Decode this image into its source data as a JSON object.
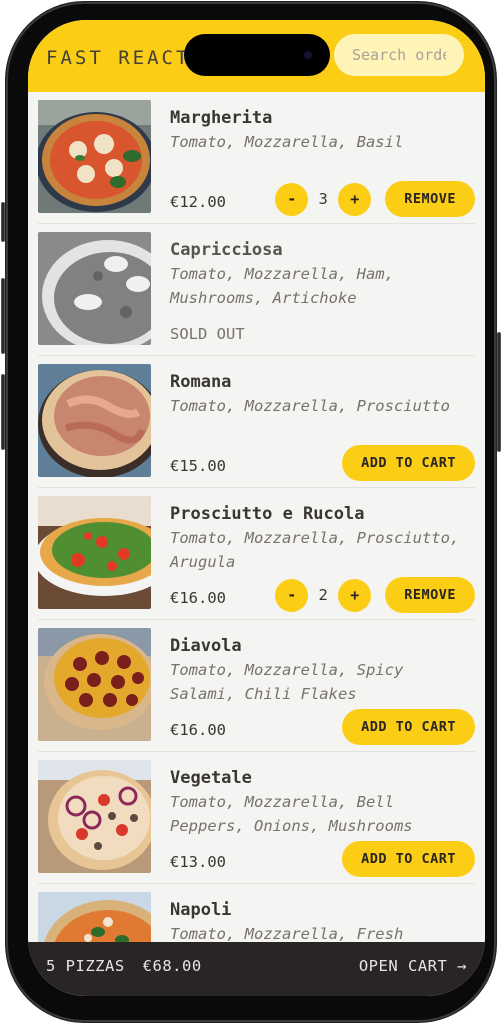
{
  "header": {
    "brand": "FAST REACT",
    "search_placeholder": "Search order #"
  },
  "colors": {
    "accent": "#fbcd15",
    "search_bg": "#fef4b8",
    "cart_bar_bg": "#292524",
    "text_primary": "#3a3632",
    "text_muted": "#78716c"
  },
  "menu": [
    {
      "name": "Margherita",
      "ingredients": "Tomato, Mozzarella, Basil",
      "price": "€12.00",
      "sold_out": false,
      "in_cart": true,
      "quantity": "3",
      "decrement": "-",
      "increment": "+",
      "remove_label": "REMOVE",
      "image": "margherita-pizza-photo"
    },
    {
      "name": "Capricciosa",
      "ingredients": "Tomato, Mozzarella, Ham, Mushrooms, Artichoke",
      "sold_out": true,
      "sold_out_label": "SOLD OUT",
      "image": "capricciosa-pizza-photo"
    },
    {
      "name": "Romana",
      "ingredients": "Tomato, Mozzarella, Prosciutto",
      "price": "€15.00",
      "sold_out": false,
      "in_cart": false,
      "add_label": "ADD TO CART",
      "image": "romana-pizza-photo"
    },
    {
      "name": "Prosciutto e Rucola",
      "ingredients": "Tomato, Mozzarella, Prosciutto, Arugula",
      "price": "€16.00",
      "sold_out": false,
      "in_cart": true,
      "quantity": "2",
      "decrement": "-",
      "increment": "+",
      "remove_label": "REMOVE",
      "image": "prosciutto-rucola-pizza-photo"
    },
    {
      "name": "Diavola",
      "ingredients": "Tomato, Mozzarella, Spicy Salami, Chili Flakes",
      "price": "€16.00",
      "sold_out": false,
      "in_cart": false,
      "add_label": "ADD TO CART",
      "image": "diavola-pizza-photo"
    },
    {
      "name": "Vegetale",
      "ingredients": "Tomato, Mozzarella, Bell Peppers, Onions, Mushrooms",
      "price": "€13.00",
      "sold_out": false,
      "in_cart": false,
      "add_label": "ADD TO CART",
      "image": "vegetale-pizza-photo"
    },
    {
      "name": "Napoli",
      "ingredients": "Tomato, Mozzarella, Fresh",
      "image": "napoli-pizza-photo"
    }
  ],
  "cart": {
    "count_label": "5 PIZZAS",
    "total": "€68.00",
    "open_label": "OPEN CART →"
  }
}
